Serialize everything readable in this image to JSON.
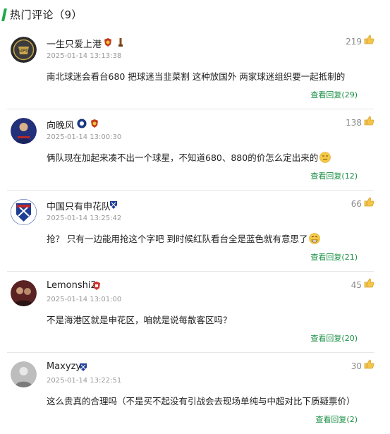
{
  "section": {
    "title": "热门评论（9）"
  },
  "comments": [
    {
      "username": "一生只爱上港",
      "time": "2025-01-14 13:13:38",
      "likes": "219",
      "text": "南北球迷会看台680 把球迷当韭菜割 这种放国外 两家球迷组织要一起抵制的",
      "replies": "查看回复(29)",
      "avatar_color": "#2b2b2b"
    },
    {
      "username": "向晚风",
      "time": "2025-01-14 13:00:30",
      "likes": "138",
      "text": "俩队现在加起来凑不出一个球星，不知道680、880的价怎么定出来的",
      "replies": "查看回复(12)",
      "avatar_color": "#23307a"
    },
    {
      "username": "中国只有申花队",
      "time": "2025-01-14 13:25:42",
      "likes": "66",
      "text": "抢？ 只有一边能用抢这个字吧 到时候红队看台全是蓝色就有意思了",
      "replies": "查看回复(21)",
      "avatar_color": "#1e3f95"
    },
    {
      "username": "Lemonshi2",
      "time": "2025-01-14 13:01:00",
      "likes": "45",
      "text": "不是海港区就是申花区，咱就是说每散客区吗？",
      "replies": "查看回复(20)",
      "avatar_color": "#6b2a2a"
    },
    {
      "username": "Maxyzy",
      "time": "2025-01-14 13:22:51",
      "likes": "30",
      "text": "这么贵真的合理吗（不是买不起没有引战会去现场单纯与中超对比下质疑票价）",
      "replies": "查看回复(2)",
      "avatar_color": "#8a8a8a"
    }
  ],
  "colors": {
    "accent_green": "#1fa84a",
    "reply_link": "#1a8f45",
    "like_yellow": "#e6a817"
  }
}
